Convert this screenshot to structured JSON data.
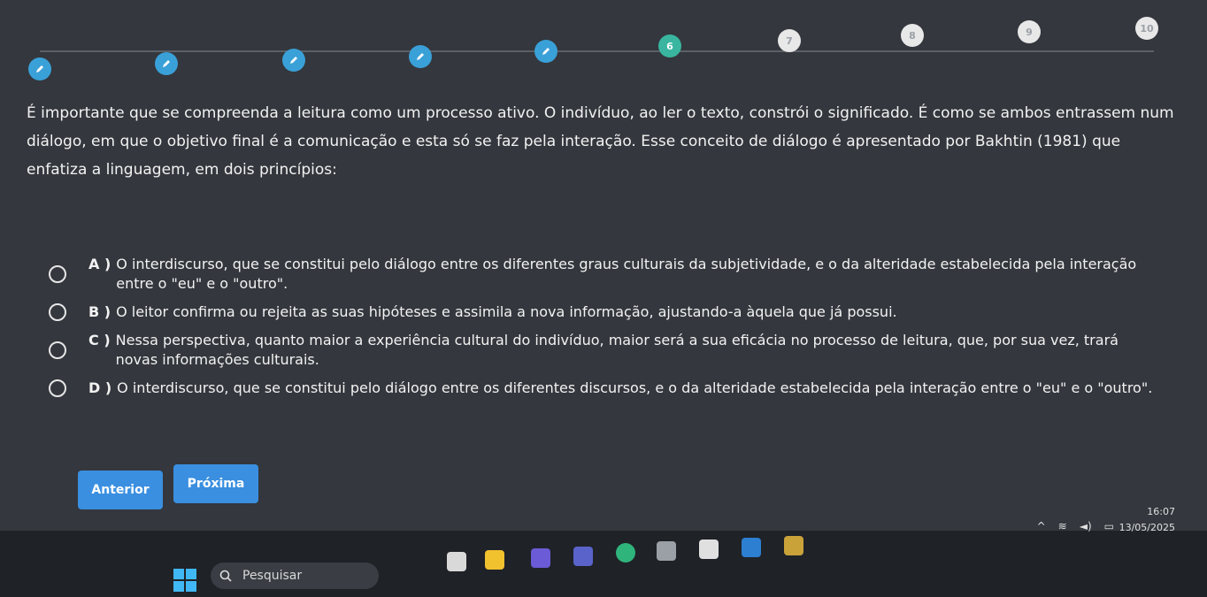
{
  "progress": {
    "steps": [
      {
        "label": "",
        "state": "done"
      },
      {
        "label": "",
        "state": "done"
      },
      {
        "label": "",
        "state": "done"
      },
      {
        "label": "",
        "state": "done"
      },
      {
        "label": "",
        "state": "done"
      },
      {
        "label": "6",
        "state": "current"
      },
      {
        "label": "7",
        "state": "todo"
      },
      {
        "label": "8",
        "state": "todo"
      },
      {
        "label": "9",
        "state": "todo"
      },
      {
        "label": "10",
        "state": "todo"
      }
    ]
  },
  "question": {
    "text": "É importante que se compreenda a leitura como um processo ativo. O indivíduo, ao ler o texto, constrói o significado. É como se ambos entrassem num diálogo, em que o objetivo final é a comunicação e esta só se faz pela interação. Esse conceito de diálogo é apresentado por Bakhtin (1981) que enfatiza a linguagem, em dois princípios:"
  },
  "options": [
    {
      "letter": "A )",
      "text": "O interdiscurso, que se constitui pelo diálogo entre os diferentes graus culturais da subjetividade, e o da alteridade estabelecida pela interação entre o \"eu\" e o \"outro\"."
    },
    {
      "letter": "B )",
      "text": "O leitor confirma ou rejeita as suas hipóteses e assimila a nova informação, ajustando-a àquela que já possui."
    },
    {
      "letter": "C )",
      "text": "Nessa perspectiva, quanto maior a experiência cultural do indivíduo, maior será a sua eficácia no processo de leitura, que, por sua vez, trará novas informações culturais."
    },
    {
      "letter": "D )",
      "text": "O interdiscurso, que se constitui pelo diálogo entre os diferentes discursos, e o da alteridade estabelecida pela interação entre o \"eu\" e o \"outro\"."
    }
  ],
  "nav": {
    "prev_label": "Anterior",
    "next_label": "Próxima"
  },
  "taskbar": {
    "search_placeholder": "Pesquisar",
    "time": "16:07",
    "date": "13/05/2025"
  },
  "colors": {
    "accent": "#3a8fe0",
    "done": "#3aa0d8",
    "current": "#39b5a0"
  }
}
